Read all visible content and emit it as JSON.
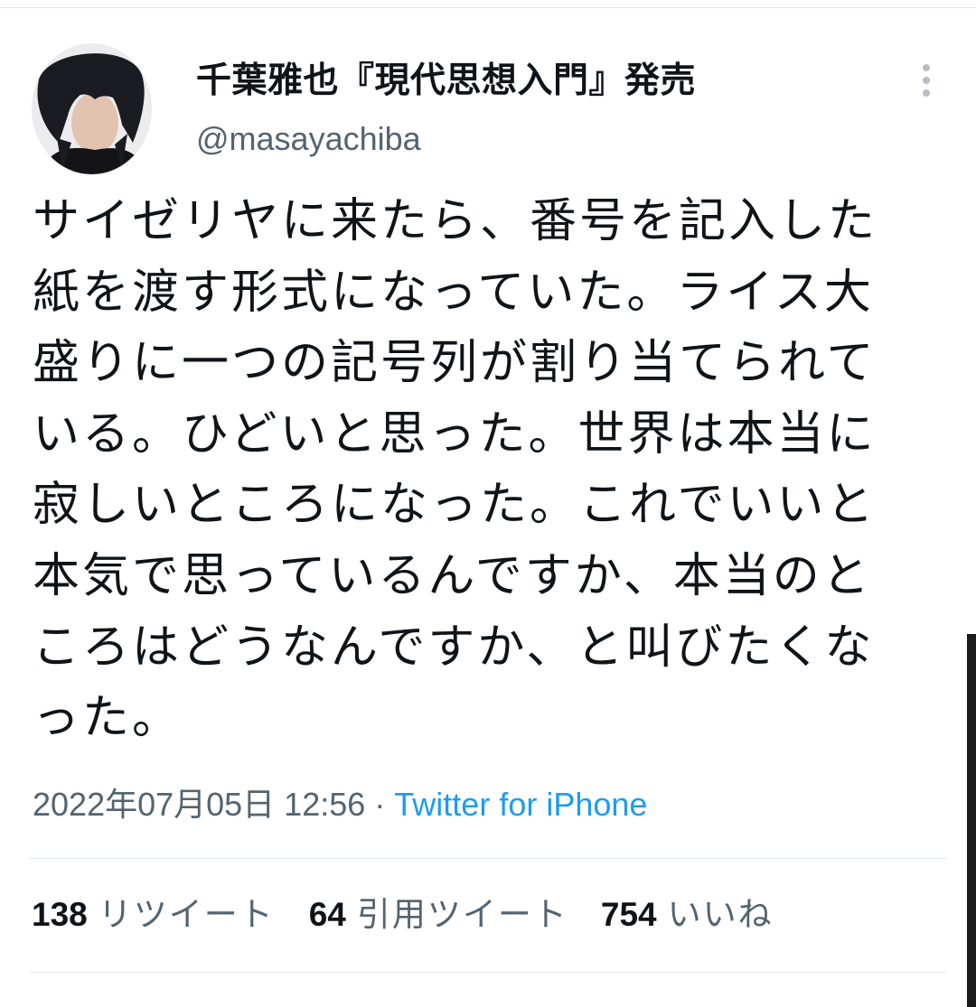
{
  "tweet": {
    "display_name": "千葉雅也『現代思想入門』発売",
    "handle": "@masayachiba",
    "text": "サイゼリヤに来たら、番号を記入した紙を渡す形式になっていた。ライス大盛りに一つの記号列が割り当てられている。ひどいと思った。世界は本当に寂しいところになった。これでいいと本気で思っているんですか、本当のところはどうなんですか、と叫びたくなった。",
    "timestamp": "2022年07月05日 12:56",
    "separator": "·",
    "source": "Twitter for iPhone"
  },
  "stats": {
    "retweets": {
      "count": "138",
      "label": "リツイート"
    },
    "quotes": {
      "count": "64",
      "label": "引用ツイート"
    },
    "likes": {
      "count": "754",
      "label": "いいね"
    }
  },
  "icons": {
    "more": "more-vertical-icon",
    "avatar": "profile-photo"
  },
  "colors": {
    "text": "#0f1419",
    "secondary": "#536471",
    "link": "#1d9bf0",
    "divider": "#dfe4e8"
  }
}
